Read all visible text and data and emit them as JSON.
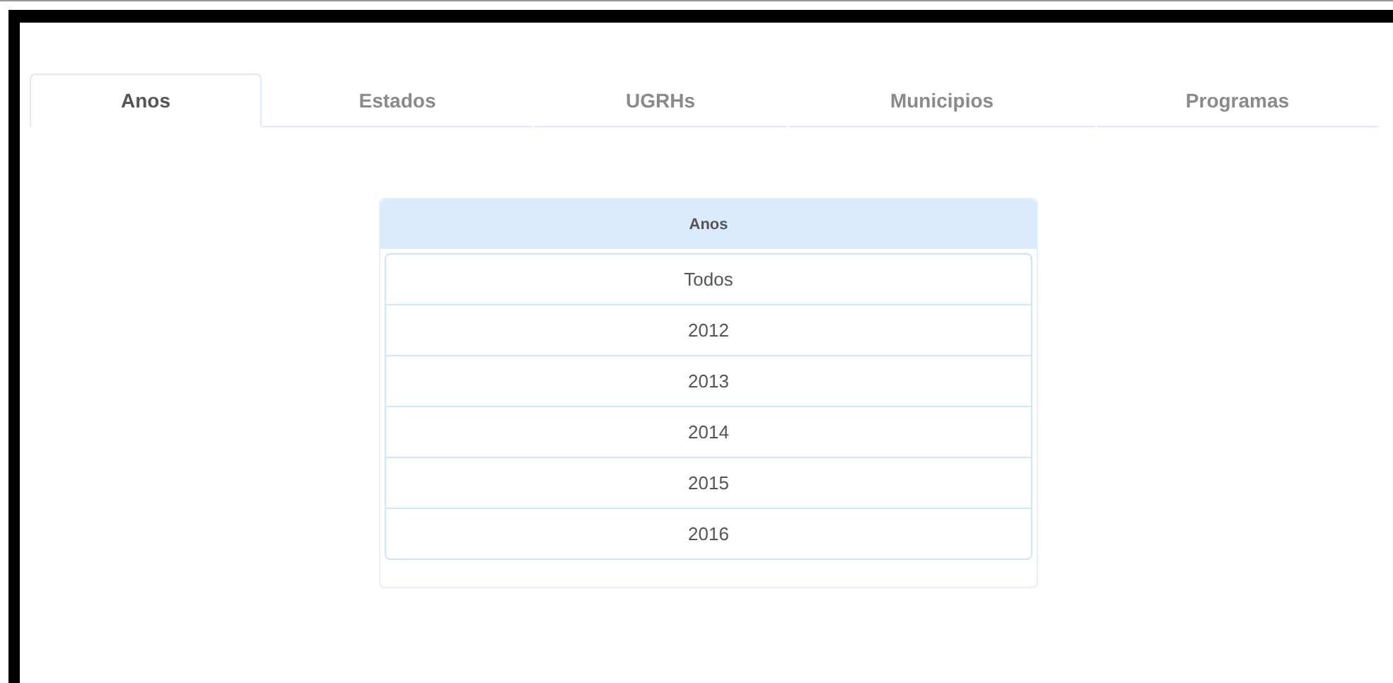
{
  "tabs": [
    {
      "label": "Anos",
      "selected": true
    },
    {
      "label": "Estados",
      "selected": false
    },
    {
      "label": "UGRHs",
      "selected": false
    },
    {
      "label": "Municipios",
      "selected": false
    },
    {
      "label": "Programas",
      "selected": false
    }
  ],
  "panel": {
    "title": "Anos",
    "items": [
      {
        "label": "Todos"
      },
      {
        "label": "2012"
      },
      {
        "label": "2013"
      },
      {
        "label": "2014"
      },
      {
        "label": "2015"
      },
      {
        "label": "2016"
      }
    ]
  }
}
